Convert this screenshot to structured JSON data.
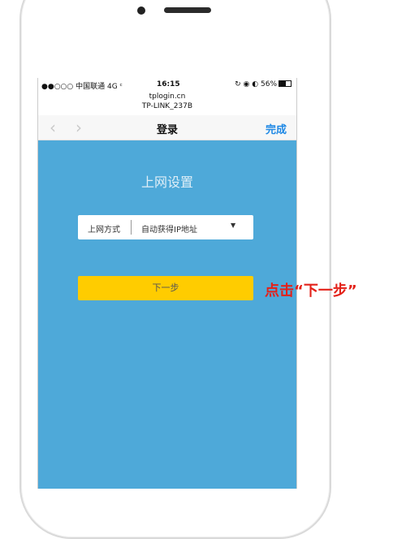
{
  "status_bar": {
    "carrier": "●●○○○ 中国联通  4G  ᶜ",
    "time": "16:15",
    "right_indicators": "↻ ◉ ◐ 56%"
  },
  "url_bar": {
    "domain": "tplogin.cn",
    "page": "TP-LINK_237B"
  },
  "nav": {
    "back_glyph": "‹",
    "forward_glyph": "›",
    "title": "登录",
    "done_label": "完成"
  },
  "content": {
    "section_title": "上网设置",
    "connection_type": {
      "label": "上网方式",
      "value": "自动获得IP地址",
      "caret": "▼"
    },
    "next_button_label": "下一步"
  },
  "annotation": {
    "text": "点击“下一步”",
    "color": "#e32119"
  },
  "colors": {
    "content_background": "#4ea9d9",
    "next_button": "#ffcc00",
    "done_link": "#1e88e5"
  }
}
